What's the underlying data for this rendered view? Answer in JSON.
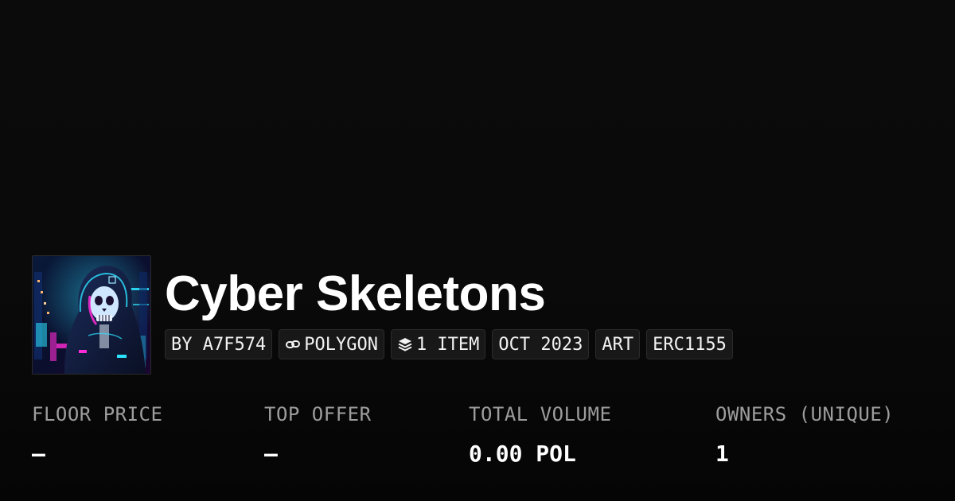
{
  "collection": {
    "name": "Cyber Skeletons",
    "avatar_alt": "cyber skeleton in hood artwork"
  },
  "chips": {
    "creator": "BY A7F574",
    "chain": "POLYGON",
    "chain_icon": "link-icon",
    "items": "1 ITEM",
    "items_icon": "layers-icon",
    "date": "OCT 2023",
    "category": "ART",
    "standard": "ERC1155"
  },
  "stats": {
    "floor_price": {
      "label": "FLOOR PRICE",
      "value": "–"
    },
    "top_offer": {
      "label": "TOP OFFER",
      "value": "–"
    },
    "total_volume": {
      "label": "TOTAL VOLUME",
      "value": "0.00 POL"
    },
    "owners": {
      "label": "OWNERS (UNIQUE)",
      "value": "1"
    }
  },
  "colors": {
    "background": "#0a0a0a",
    "chip_background": "#181818",
    "label": "#9d9d9d",
    "text": "#ffffff",
    "neon_cyan": "#2de2ff",
    "neon_magenta": "#ff2bd6"
  }
}
